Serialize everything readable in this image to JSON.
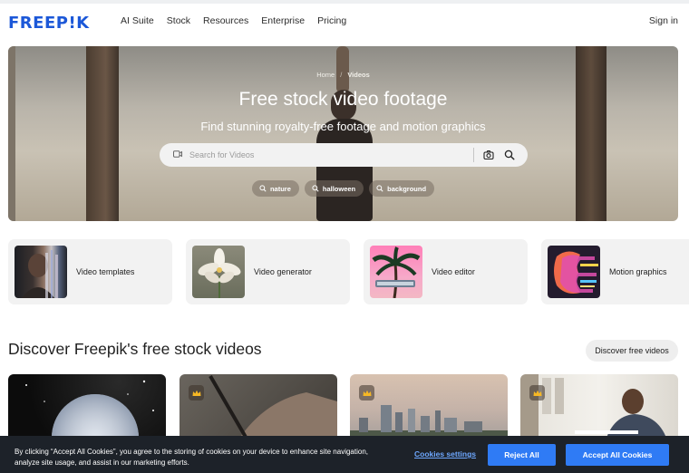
{
  "nav": {
    "logo": "FREEP!K",
    "links": [
      "AI Suite",
      "Stock",
      "Resources",
      "Enterprise",
      "Pricing"
    ],
    "sign_in": "Sign in"
  },
  "hero": {
    "breadcrumb_home": "Home",
    "breadcrumb_current": "Videos",
    "title": "Free stock video footage",
    "subtitle": "Find stunning royalty-free footage and motion graphics",
    "search_placeholder": "Search for Videos",
    "chips": [
      "nature",
      "halloween",
      "background"
    ]
  },
  "categories": [
    {
      "label": "Video templates",
      "icon": "portrait-glitch-thumbnail"
    },
    {
      "label": "Video generator",
      "icon": "white-flower-thumbnail"
    },
    {
      "label": "Video editor",
      "icon": "palm-tree-thumbnail"
    },
    {
      "label": "Motion graphics",
      "icon": "colorful-face-thumbnail"
    }
  ],
  "section": {
    "title": "Discover Freepik's free stock videos",
    "discover_button": "Discover free videos"
  },
  "videos": [
    {
      "thumb": "sparkling-globe",
      "premium": false
    },
    {
      "thumb": "hand-writing",
      "premium": true
    },
    {
      "thumb": "city-skyline",
      "premium": true
    },
    {
      "thumb": "man-at-desk",
      "premium": true
    }
  ],
  "cookie": {
    "text": "By clicking “Accept All Cookies”, you agree to the storing of cookies on your device to enhance site navigation, analyze site usage, and assist in our marketing efforts.",
    "settings": "Cookies settings",
    "reject": "Reject All",
    "accept": "Accept All Cookies"
  },
  "colors": {
    "brand": "#1c58d8",
    "cookie_bg": "#1d2229",
    "cookie_button": "#2f7bf5"
  }
}
